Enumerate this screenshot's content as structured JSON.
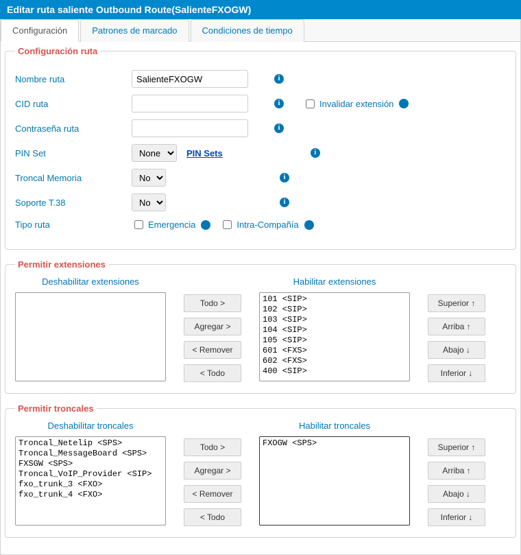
{
  "header": {
    "title": "Editar ruta saliente Outbound Route(SalienteFXOGW)"
  },
  "tabs": {
    "config": "Configuración",
    "patterns": "Patrones de marcado",
    "conditions": "Condiciones de tiempo"
  },
  "routeConfig": {
    "legend": "Configuración ruta",
    "nameLabel": "Nombre ruta",
    "nameValue": "SalienteFXOGW",
    "cidLabel": "CID ruta",
    "cidValue": "",
    "overrideExtLabel": "Invalidar extensión",
    "passwordLabel": "Contraseña ruta",
    "passwordValue": "",
    "pinSetLabel": "PIN Set",
    "pinSetValue": "None",
    "pinSetsLink": "PIN Sets",
    "memTrunkLabel": "Troncal Memoria",
    "memTrunkValue": "No",
    "t38Label": "Soporte T.38",
    "t38Value": "No",
    "typeLabel": "Tipo ruta",
    "emergencyLabel": "Emergencia",
    "intraLabel": "Intra-Compañía"
  },
  "allowExt": {
    "legend": "Permitir extensiones",
    "disableHeader": "Deshabilitar extensiones",
    "enableHeader": "Habilitar extensiones",
    "enabled": [
      "101 <SIP>",
      "102 <SIP>",
      "103 <SIP>",
      "104 <SIP>",
      "105 <SIP>",
      "601 <FXS>",
      "602 <FXS>",
      "400 <SIP>"
    ]
  },
  "allowTrunk": {
    "legend": "Permitir troncales",
    "disableHeader": "Deshabilitar troncales",
    "enableHeader": "Habilitar troncales",
    "disabled": [
      "Troncal_Netelip <SPS>",
      "Troncal_MessageBoard <SPS>",
      "FXSGW <SPS>",
      "Troncal_VoIP_Provider <SIP>",
      "fxo_trunk_3 <FXO>",
      "fxo_trunk_4 <FXO>"
    ],
    "enabled": [
      "FXOGW <SPS>"
    ]
  },
  "moveBtns": {
    "all": "Todo >",
    "add": "Agregar >",
    "remove": "< Remover",
    "allBack": "< Todo"
  },
  "orderBtns": {
    "top": "Superior ↑",
    "up": "Arriba ↑",
    "down": "Abajo ↓",
    "bottom": "Inferior ↓"
  }
}
